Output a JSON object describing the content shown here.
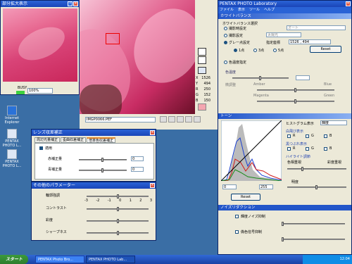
{
  "magnify": {
    "title": "部分拡大表示",
    "busy_label": "BUSY",
    "zoom_value": "100%"
  },
  "main": {
    "title": "PENTAX PHOTO Laboratory",
    "menu": [
      "ファイル",
      "表示",
      "ツール",
      "ヘルプ"
    ],
    "readouts": [
      {
        "label": "X",
        "value": "1526"
      },
      {
        "label": "Y",
        "value": "494"
      },
      {
        "label": "R",
        "value": "250"
      },
      {
        "label": "G",
        "value": "152"
      },
      {
        "label": "B",
        "value": "150"
      }
    ],
    "filename": "IMGP0066.PEF"
  },
  "wb": {
    "header": "ホワイトバランス",
    "select_label": "ホワイトバランス選択",
    "options": [
      "撮影時設定",
      "撮影設定",
      "グレー点設定"
    ],
    "auto_value": "オート",
    "sun_value": "太陽光",
    "coord_label": "指定座標",
    "coord_value": "1526 , 494",
    "points": [
      "1点",
      "3点",
      "5点"
    ],
    "reset": "Reset",
    "color_temp": "色温度指定",
    "fine": "色温度",
    "fine_adj": "微調整",
    "amber": "Amber",
    "blue": "Blue",
    "magenta": "Magenta",
    "green": "Green"
  },
  "tone": {
    "header": "トーン",
    "hist_label": "ヒストグラム表示",
    "hist_value": "輝度",
    "white_label": "白飛び表示",
    "black_label": "黒つぶれ表示",
    "highlight_label": "ハイライト調節",
    "rgb": [
      "R",
      "G",
      "B"
    ],
    "hue": "色相重視",
    "sat": "彩度重視",
    "bright": "明度",
    "left_value": "0",
    "right_value": "255",
    "reset": "Reset"
  },
  "noise": {
    "header": "ノイズリダクション",
    "luma": "輝度ノイズ抑制",
    "chroma": "偽色信号抑制"
  },
  "lens": {
    "title": "レンズ収差補正",
    "tabs": [
      "周辺光量補正",
      "歪曲収差補正",
      "倍率色収差補正"
    ],
    "apply": "適用",
    "red": "赤補正量",
    "blue": "青補正量",
    "red_value": "0",
    "blue_value": "0"
  },
  "params": {
    "title": "その他のパラメーター",
    "scale": [
      "-3",
      "-2",
      "-1",
      "0",
      "1",
      "2",
      "3"
    ],
    "items": [
      "輪郭強調",
      "コントラスト",
      "彩度",
      "シャープネス"
    ]
  },
  "desktop": {
    "icons": [
      "Internet Explorer",
      "PENTAX PHOTO L...",
      "PENTAX PHOTO L..."
    ]
  },
  "taskbar": {
    "start": "スタート",
    "tasks": [
      "PENTAX Photo Bro...",
      "PENTAX PHOTO Lab..."
    ],
    "clock": "12:04"
  }
}
